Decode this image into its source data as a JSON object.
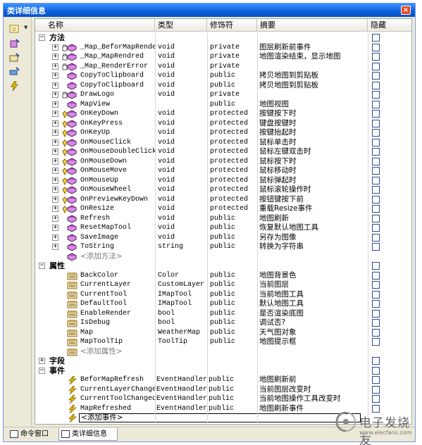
{
  "window": {
    "title": "类详细信息",
    "close": "×"
  },
  "columns": {
    "name": "名称",
    "type": "类型",
    "modifier": "修饰符",
    "summary": "摘要",
    "hidden": "隐藏"
  },
  "groups": {
    "methods": "方法",
    "properties": "属性",
    "fields": "字段",
    "events": "事件"
  },
  "methods": [
    {
      "name": "_Map_BeforMapRende",
      "type": "void",
      "modifier": "private",
      "summary": "图层刷新前事件",
      "kind": "private"
    },
    {
      "name": "_Map_MapRendred",
      "type": "void",
      "modifier": "private",
      "summary": "地图渲染结束，显示地图",
      "kind": "private"
    },
    {
      "name": "_Map_RenderError",
      "type": "void",
      "modifier": "private",
      "summary": "",
      "kind": "private"
    },
    {
      "name": "CopyToClipboard",
      "type": "void",
      "modifier": "public",
      "summary": "拷贝地图到剪贴板",
      "kind": "public"
    },
    {
      "name": "CopyToClipboard",
      "type": "void",
      "modifier": "public",
      "summary": "拷贝地图到剪贴板",
      "kind": "public"
    },
    {
      "name": "DrawLogo",
      "type": "void",
      "modifier": "private",
      "summary": "",
      "kind": "private"
    },
    {
      "name": "MapView",
      "type": "",
      "modifier": "public",
      "summary": "地图视图",
      "kind": "public"
    },
    {
      "name": "OnKeyDown",
      "type": "void",
      "modifier": "protected",
      "summary": "按键按下时",
      "kind": "protected"
    },
    {
      "name": "OnKeyPress",
      "type": "void",
      "modifier": "protected",
      "summary": "键盘按键时",
      "kind": "protected"
    },
    {
      "name": "OnKeyUp",
      "type": "void",
      "modifier": "protected",
      "summary": "按键抬起时",
      "kind": "protected"
    },
    {
      "name": "OnMouseClick",
      "type": "void",
      "modifier": "protected",
      "summary": "鼠标单击时",
      "kind": "protected"
    },
    {
      "name": "OnMouseDoubleClick",
      "type": "void",
      "modifier": "protected",
      "summary": "鼠标左键双击时",
      "kind": "protected"
    },
    {
      "name": "OnMouseDown",
      "type": "void",
      "modifier": "protected",
      "summary": "鼠标按下时",
      "kind": "protected"
    },
    {
      "name": "OnMouseMove",
      "type": "void",
      "modifier": "protected",
      "summary": "鼠标移动时",
      "kind": "protected"
    },
    {
      "name": "OnMouseUp",
      "type": "void",
      "modifier": "protected",
      "summary": "鼠标弹起时",
      "kind": "protected"
    },
    {
      "name": "OnMouseWheel",
      "type": "void",
      "modifier": "protected",
      "summary": "鼠标滚轮操作时",
      "kind": "protected"
    },
    {
      "name": "OnPreviewKeyDown",
      "type": "void",
      "modifier": "protected",
      "summary": "按钮键按下前",
      "kind": "protected"
    },
    {
      "name": "OnResize",
      "type": "void",
      "modifier": "protected",
      "summary": "重载Resize事件",
      "kind": "protected"
    },
    {
      "name": "Refresh",
      "type": "void",
      "modifier": "public",
      "summary": "地图刷新",
      "kind": "public"
    },
    {
      "name": "ResetMapTool",
      "type": "void",
      "modifier": "public",
      "summary": "恢复默认地图工具",
      "kind": "public"
    },
    {
      "name": "SaveImage",
      "type": "void",
      "modifier": "public",
      "summary": "另存为图像",
      "kind": "public"
    },
    {
      "name": "ToString",
      "type": "string",
      "modifier": "public",
      "summary": "转换为字符串",
      "kind": "public"
    }
  ],
  "add_method": "<添加方法>",
  "properties": [
    {
      "name": "BackColor",
      "type": "Color",
      "modifier": "public",
      "summary": "地图背景色"
    },
    {
      "name": "CurrentLayer",
      "type": "CustomLayer",
      "modifier": "public",
      "summary": "当前图层"
    },
    {
      "name": "CurrentTool",
      "type": "IMapTool",
      "modifier": "public",
      "summary": "当前地图工具"
    },
    {
      "name": "DefaultTool",
      "type": "IMapTool",
      "modifier": "public",
      "summary": "默认地图工具"
    },
    {
      "name": "EnableRender",
      "type": "bool",
      "modifier": "public",
      "summary": "是否渲染底图"
    },
    {
      "name": "IsDebug",
      "type": "bool",
      "modifier": "public",
      "summary": "调试否?"
    },
    {
      "name": "Map",
      "type": "WeatherMap",
      "modifier": "public",
      "summary": "天气图对象"
    },
    {
      "name": "MapToolTip",
      "type": "ToolTip",
      "modifier": "public",
      "summary": "地图提示框"
    }
  ],
  "add_property": "<添加属性>",
  "events": [
    {
      "name": "BeforMapRefresh",
      "type": "EventHandler",
      "modifier": "public",
      "summary": "地图刷新前"
    },
    {
      "name": "CurrentLayerChange",
      "type": "EventHandler",
      "modifier": "public",
      "summary": "当前图层改变时"
    },
    {
      "name": "CurrentToolChanged",
      "type": "EventHandler",
      "modifier": "public",
      "summary": "当前地图操作工具改变时"
    },
    {
      "name": "MapRefreshed",
      "type": "EventHandler",
      "modifier": "public",
      "summary": "地图刷新事件"
    }
  ],
  "add_event": "<添加事件>",
  "tabs": {
    "command_window": "命令窗口",
    "class_details": "类详细信息"
  },
  "watermark": {
    "brand": "电子发烧友",
    "url": "www.elecfans.com"
  },
  "colors": {
    "title_bar": "#0a5fd8",
    "method_icon": "#b14bc8",
    "property_icon": "#8a6a2a",
    "event_icon": "#e3b700"
  }
}
